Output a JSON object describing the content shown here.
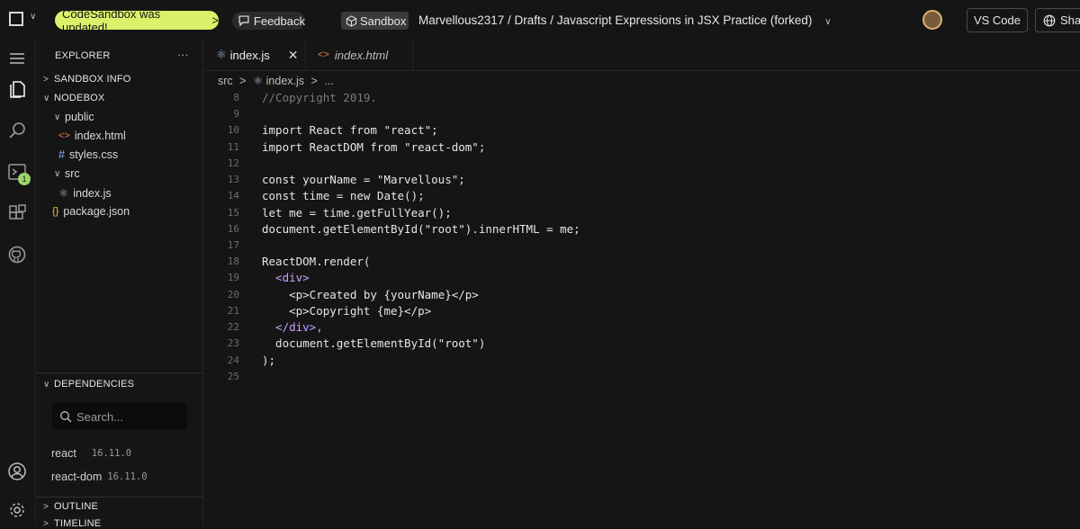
{
  "topbar": {
    "update_label": "CodeSandbox was updated!",
    "update_chevron": ">",
    "feedback_label": "Feedback",
    "sandbox_label": "Sandbox",
    "path": "Marvellous2317 / Drafts / Javascript Expressions in JSX Practice (forked)",
    "vscode_label": "VS Code",
    "share_label": "Sha"
  },
  "activity": {
    "badge_count": "1"
  },
  "explorer": {
    "title": "EXPLORER",
    "more": "···",
    "sandbox_info": "SANDBOX INFO",
    "nodebox": "NODEBOX",
    "folder_public": "public",
    "file_index_html": "index.html",
    "file_styles_css": "styles.css",
    "folder_src": "src",
    "file_index_js": "index.js",
    "file_package_json": "package.json",
    "dependencies_title": "DEPENDENCIES",
    "search_placeholder": "Search...",
    "dependencies": [
      {
        "name": "react",
        "version": "16.11.0"
      },
      {
        "name": "react-dom",
        "version": "16.11.0"
      }
    ],
    "outline_title": "OUTLINE",
    "timeline_title": "TIMELINE"
  },
  "tabs": [
    {
      "label": "index.js"
    },
    {
      "label": "index.html"
    }
  ],
  "editor_breadcrumb": {
    "folder": "src",
    "file": "index.js",
    "trail": "..."
  },
  "code_lines": [
    {
      "n": "8"
    },
    {
      "n": "9"
    },
    {
      "n": "10"
    },
    {
      "n": "11"
    },
    {
      "n": "12"
    },
    {
      "n": "13"
    },
    {
      "n": "14"
    },
    {
      "n": "15"
    },
    {
      "n": "16"
    },
    {
      "n": "17"
    },
    {
      "n": "18"
    },
    {
      "n": "19"
    },
    {
      "n": "20"
    },
    {
      "n": "21"
    },
    {
      "n": "22"
    },
    {
      "n": "23"
    },
    {
      "n": "24"
    },
    {
      "n": "25"
    }
  ],
  "code": {
    "l8": "//Copyright 2019.",
    "l10": "import React from \"react\";",
    "l11": "import ReactDOM from \"react-dom\";",
    "l13": "const yourName = \"Marvellous\";",
    "l14": "const time = new Date();",
    "l15": "let me = time.getFullYear();",
    "l16": "document.getElementById(\"root\").innerHTML = me;",
    "l18": "ReactDOM.render(",
    "l19": "  <div>",
    "l20": "    <p>Created by {yourName}</p>",
    "l21": "    <p>Copyright {me}</p>",
    "l22": "  </div>,",
    "l23": "  document.getElementById(\"root\")",
    "l24": ");"
  }
}
